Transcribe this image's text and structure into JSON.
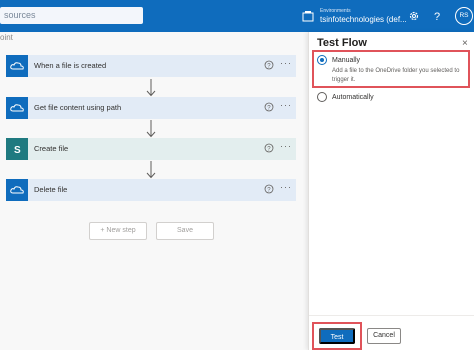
{
  "topbar": {
    "search_placeholder": "sources",
    "env_label": "Environments",
    "env_value": "tsinfotechnologies (def...",
    "avatar_initials": "RS",
    "bar_color": "#0f6cbd"
  },
  "canvas": {
    "breadcrumb": "oint",
    "steps": [
      {
        "title": "When a file is created",
        "icon": "cloud-icon"
      },
      {
        "title": "Get file content using path",
        "icon": "cloud-icon"
      },
      {
        "title": "Create file",
        "icon": "sharepoint-icon",
        "icon_letter": "S"
      },
      {
        "title": "Delete file",
        "icon": "cloud-icon"
      }
    ],
    "new_step_label": "+ New step",
    "save_label": "Save"
  },
  "panel": {
    "title": "Test Flow",
    "close_glyph": "×",
    "option_manual": "Manually",
    "option_manual_desc": "Add a file to the OneDrive folder you selected to trigger it.",
    "option_auto": "Automatically",
    "selected": "Manually",
    "test_label": "Test",
    "cancel_label": "Cancel",
    "highlight_color": "#e0535a"
  }
}
